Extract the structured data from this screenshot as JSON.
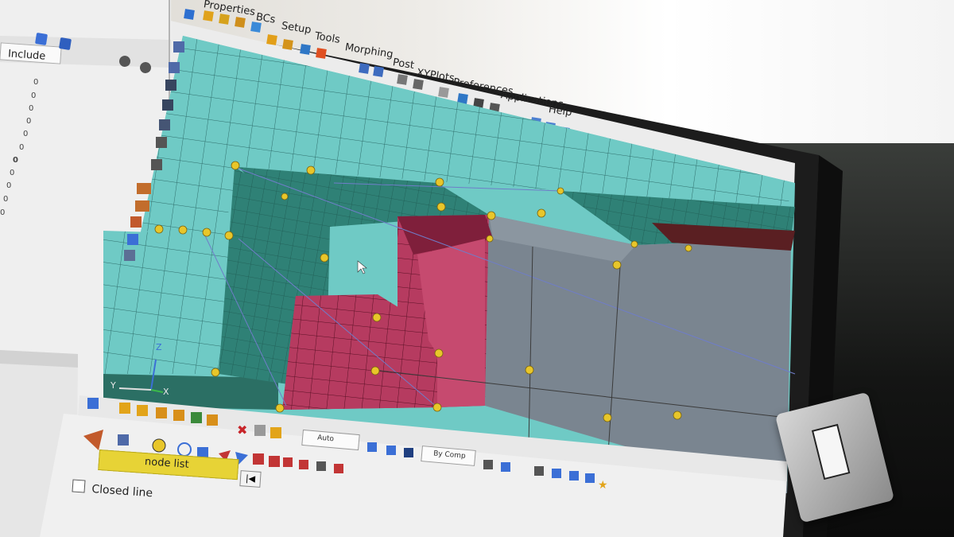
{
  "menu": [
    "Properties",
    "BCs",
    "Setup",
    "Tools",
    "Morphing",
    "Post",
    "XYPlots",
    "Preferences",
    "Applications",
    "Help"
  ],
  "side_panel": {
    "include_label": "Include",
    "values": [
      "0",
      "0",
      "0",
      "0",
      "0",
      "0",
      "0",
      "0",
      "0",
      "0",
      "0"
    ]
  },
  "bottom": {
    "node_list_label": "node list",
    "closed_line_label": "Closed line",
    "auto_value": "Auto",
    "by_comp_value": "By Comp",
    "nav_symbol": "|◀"
  },
  "triad": {
    "x": "X",
    "y": "Y",
    "z": "Z"
  },
  "colors": {
    "mesh_cyan": "#6fc9c4",
    "mesh_teal": "#2e7d72",
    "solid_magenta": "#b23a5c",
    "solid_gray": "#7d8891",
    "node_yellow": "#e7c72b",
    "node_list_bg": "#e7d336"
  },
  "icons": [
    "cursor-icon",
    "eye-icon",
    "zoom-icon",
    "pan-icon",
    "rotate-icon",
    "delete-icon",
    "line-tool-icon",
    "node-icon",
    "save-icon"
  ]
}
